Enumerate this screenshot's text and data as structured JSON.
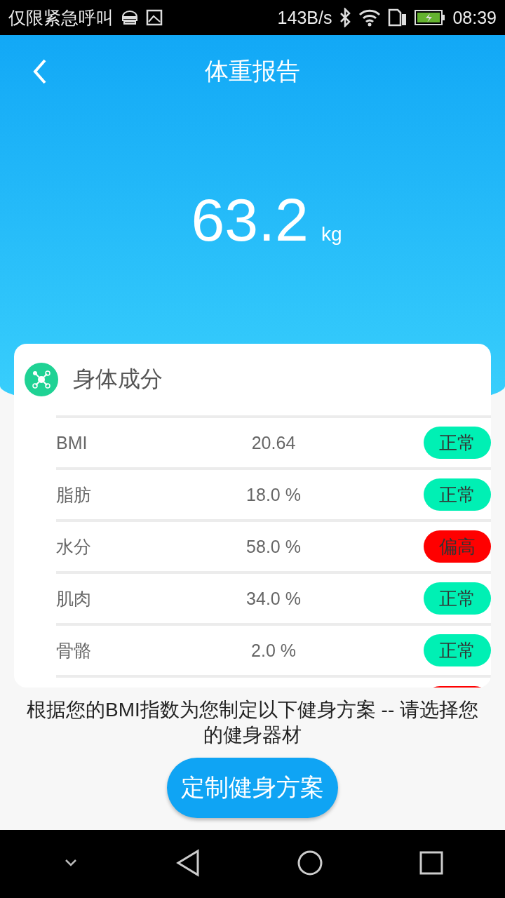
{
  "status_bar": {
    "carrier": "仅限紧急呼叫",
    "speed": "143B/s",
    "time": "08:39"
  },
  "header": {
    "title": "体重报告",
    "weight": "63.2",
    "unit": "kg"
  },
  "composition": {
    "title": "身体成分",
    "rows": [
      {
        "label": "BMI",
        "value": "20.64",
        "status": "正常",
        "color": "#00f0b4"
      },
      {
        "label": "脂肪",
        "value": "18.0 %",
        "status": "正常",
        "color": "#00f0b4"
      },
      {
        "label": "水分",
        "value": "58.0 %",
        "status": "偏高",
        "color": "#ff0000"
      },
      {
        "label": "肌肉",
        "value": "34.0 %",
        "status": "正常",
        "color": "#00f0b4"
      },
      {
        "label": "骨骼",
        "value": "2.0 %",
        "status": "正常",
        "color": "#00f0b4"
      },
      {
        "color": "#ff0000"
      }
    ]
  },
  "advice": "根据您的BMI指数为您制定以下健身方案 -- 请选择您的健身器材",
  "plan_button": "定制健身方案"
}
